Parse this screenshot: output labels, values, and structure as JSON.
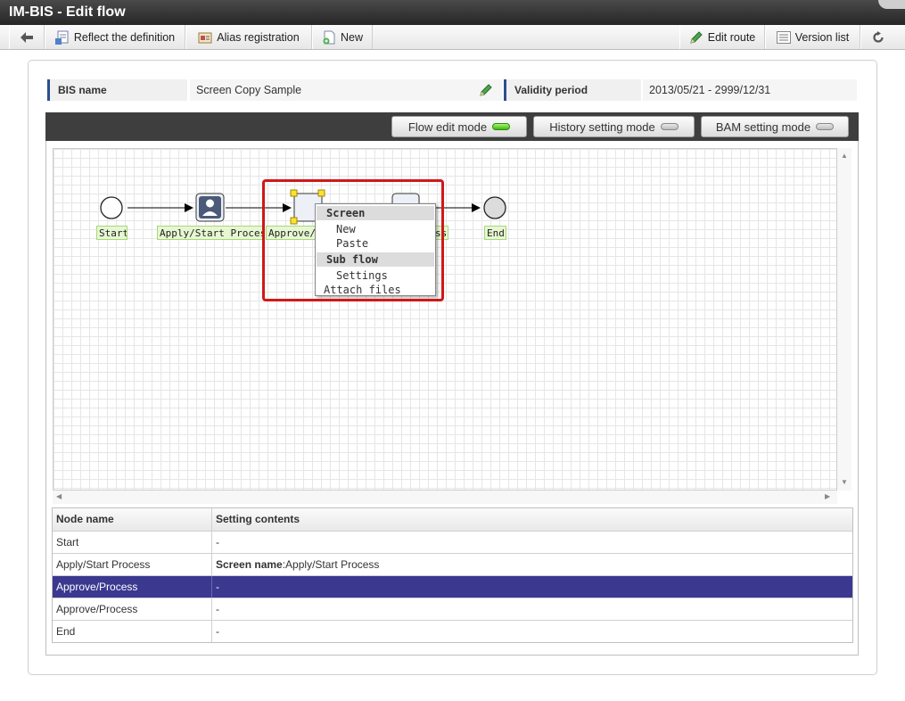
{
  "window": {
    "title": "IM-BIS - Edit flow"
  },
  "toolbar": {
    "reflect_label": "Reflect the definition",
    "alias_label": "Alias registration",
    "new_label": "New",
    "edit_route_label": "Edit route",
    "version_list_label": "Version list"
  },
  "info": {
    "bis_name_label": "BIS name",
    "bis_name_value": "Screen Copy Sample",
    "validity_label": "Validity period",
    "validity_value": "2013/05/21 - 2999/12/31"
  },
  "modes": {
    "flow_edit": "Flow edit mode",
    "history_setting": "History setting mode",
    "bam_setting": "BAM setting mode",
    "active": "flow_edit"
  },
  "flow": {
    "nodes": [
      {
        "label": "Start"
      },
      {
        "label": "Apply/Start Process"
      },
      {
        "label": "Approve/P"
      },
      {
        "label": "ss"
      },
      {
        "label": "End"
      }
    ]
  },
  "context_menu": {
    "screen_header": "Screen",
    "screen_new": "New",
    "screen_paste": "Paste",
    "subflow_header": "Sub flow",
    "subflow_settings": "Settings",
    "attach_files": "Attach files"
  },
  "table": {
    "headers": [
      "Node name",
      "Setting contents"
    ],
    "rows": [
      {
        "name": "Start",
        "prefix": "",
        "content": "-"
      },
      {
        "name": "Apply/Start Process",
        "prefix": "Screen name",
        "content": ":Apply/Start Process"
      },
      {
        "name": "Approve/Process",
        "prefix": "",
        "content": "-"
      },
      {
        "name": "Approve/Process",
        "prefix": "",
        "content": "-"
      },
      {
        "name": "End",
        "prefix": "",
        "content": "-"
      }
    ],
    "selected_row": 2
  },
  "colors": {
    "accent_bar": "#2c4e8e",
    "selected_row": "#3b3890",
    "highlight": "#d01818",
    "led_on": "#3dba14"
  }
}
